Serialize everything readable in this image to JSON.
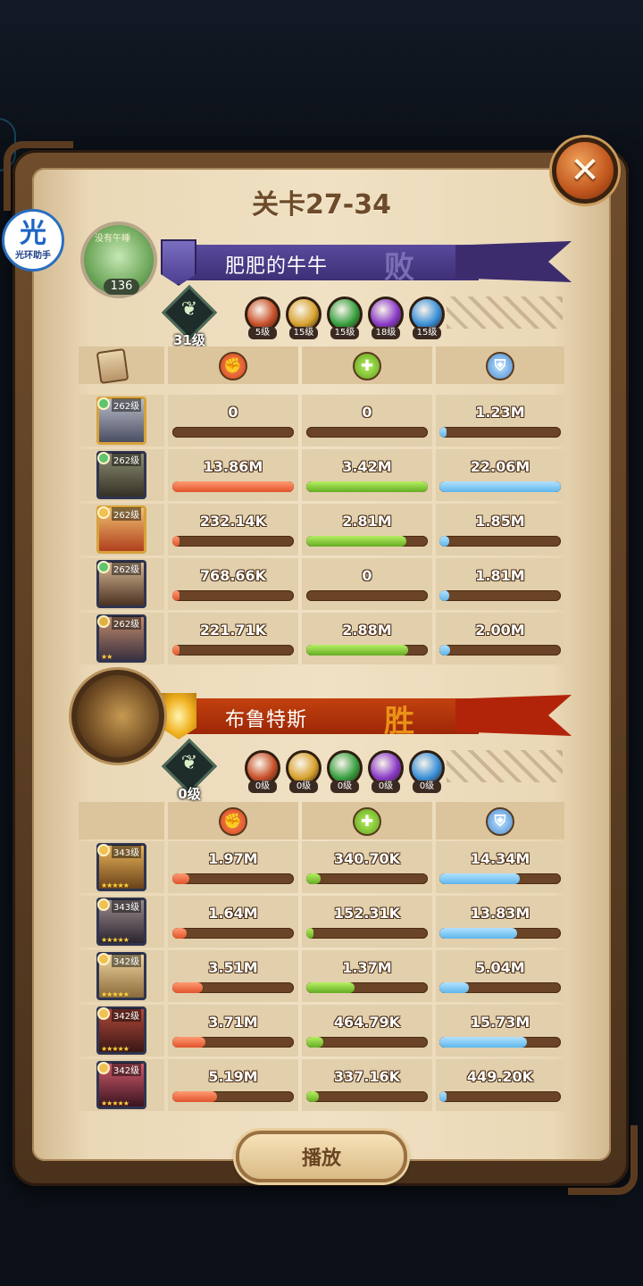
{
  "title": "关卡27-34",
  "close_icon": "close-x-icon",
  "halo_badge": {
    "char": "光",
    "label": "光环助手"
  },
  "losing_team": {
    "player_label": "没有午睡",
    "avatar_level": "136",
    "name": "肥肥的牛牛",
    "result": "败",
    "team_level": "31级",
    "factions": [
      {
        "icon": "lightbearer-icon",
        "level": "5级",
        "color": "#c8502a"
      },
      {
        "icon": "mauler-icon",
        "level": "15级",
        "color": "#d8a230"
      },
      {
        "icon": "wilder-icon",
        "level": "15级",
        "color": "#38a040"
      },
      {
        "icon": "graveborn-icon",
        "level": "18级",
        "color": "#8a3ac8"
      },
      {
        "icon": "celestial-icon",
        "level": "15级",
        "color": "#3a90d8"
      }
    ],
    "heroes": [
      {
        "level": "262级",
        "portrait": "p-a",
        "gold": true,
        "gem": "#5ec46e",
        "stars": "",
        "damage": "0",
        "damage_pct": 0,
        "heal": "0",
        "heal_pct": 0,
        "shield": "1.23M",
        "shield_pct": 0.06
      },
      {
        "level": "262级",
        "portrait": "p-b",
        "gold": false,
        "gem": "#5ec46e",
        "stars": "",
        "damage": "13.86M",
        "damage_pct": 1.0,
        "heal": "3.42M",
        "heal_pct": 1.0,
        "shield": "22.06M",
        "shield_pct": 1.0
      },
      {
        "level": "262级",
        "portrait": "p-c",
        "gold": true,
        "gem": "#f0c050",
        "stars": "",
        "damage": "232.14K",
        "damage_pct": 0.02,
        "heal": "2.81M",
        "heal_pct": 0.82,
        "shield": "1.85M",
        "shield_pct": 0.08
      },
      {
        "level": "262级",
        "portrait": "p-d",
        "gold": false,
        "gem": "#5ec46e",
        "stars": "",
        "damage": "768.66K",
        "damage_pct": 0.06,
        "heal": "0",
        "heal_pct": 0,
        "shield": "1.81M",
        "shield_pct": 0.08
      },
      {
        "level": "262级",
        "portrait": "p-e",
        "gold": false,
        "gem": "#e0b040",
        "stars": "★★",
        "damage": "221.71K",
        "damage_pct": 0.02,
        "heal": "2.88M",
        "heal_pct": 0.84,
        "shield": "2.00M",
        "shield_pct": 0.09
      }
    ]
  },
  "winning_team": {
    "name": "布鲁特斯",
    "result": "胜",
    "team_level": "0级",
    "factions": [
      {
        "icon": "lightbearer-icon",
        "level": "0级",
        "color": "#c8502a"
      },
      {
        "icon": "mauler-icon",
        "level": "0级",
        "color": "#d8a230"
      },
      {
        "icon": "wilder-icon",
        "level": "0级",
        "color": "#38a040"
      },
      {
        "icon": "graveborn-icon",
        "level": "0级",
        "color": "#8a3ac8"
      },
      {
        "icon": "celestial-icon",
        "level": "0级",
        "color": "#3a90d8"
      }
    ],
    "heroes": [
      {
        "level": "343级",
        "portrait": "p-f",
        "gold": false,
        "gem": "#f0c050",
        "stars": "★★★★★",
        "damage": "1.97M",
        "damage_pct": 0.14,
        "heal": "340.70K",
        "heal_pct": 0.12,
        "shield": "14.34M",
        "shield_pct": 0.66
      },
      {
        "level": "343级",
        "portrait": "p-g",
        "gold": false,
        "gem": "#f0c050",
        "stars": "★★★★★",
        "damage": "1.64M",
        "damage_pct": 0.12,
        "heal": "152.31K",
        "heal_pct": 0.06,
        "shield": "13.83M",
        "shield_pct": 0.64
      },
      {
        "level": "342级",
        "portrait": "p-h",
        "gold": false,
        "gem": "#f0c050",
        "stars": "★★★★★",
        "damage": "3.51M",
        "damage_pct": 0.25,
        "heal": "1.37M",
        "heal_pct": 0.4,
        "shield": "5.04M",
        "shield_pct": 0.24
      },
      {
        "level": "342级",
        "portrait": "p-i",
        "gold": false,
        "gem": "#f0c050",
        "stars": "★★★★★",
        "damage": "3.71M",
        "damage_pct": 0.27,
        "heal": "464.79K",
        "heal_pct": 0.14,
        "shield": "15.73M",
        "shield_pct": 0.72
      },
      {
        "level": "342级",
        "portrait": "p-j",
        "gold": false,
        "gem": "#f0c050",
        "stars": "★★★★★",
        "damage": "5.19M",
        "damage_pct": 0.37,
        "heal": "337.16K",
        "heal_pct": 0.1,
        "shield": "449.20K",
        "shield_pct": 0.02
      }
    ]
  },
  "column_icons": [
    "damage-icon",
    "heal-icon",
    "shield-icon"
  ],
  "play_button": "播放"
}
